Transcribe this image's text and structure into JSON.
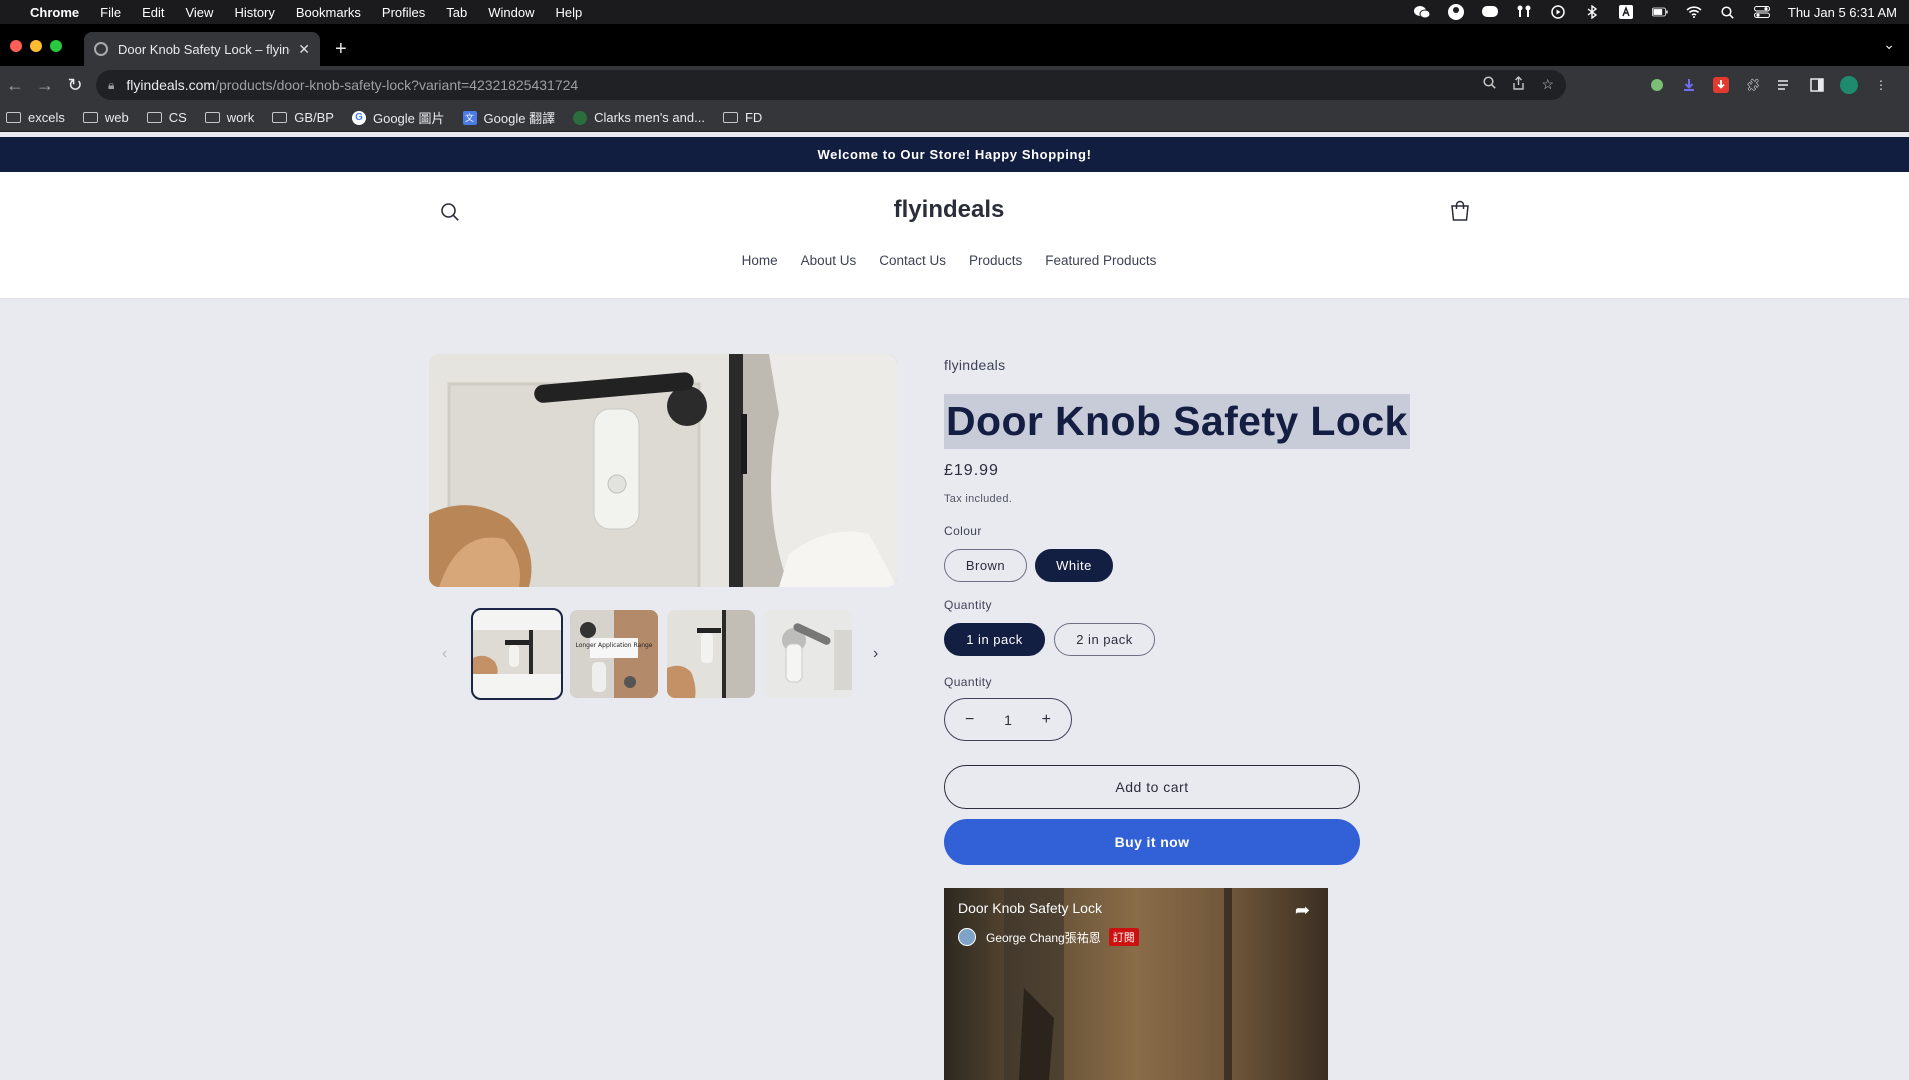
{
  "mac_menubar": {
    "app": "Chrome",
    "items": [
      "File",
      "Edit",
      "View",
      "History",
      "Bookmarks",
      "Profiles",
      "Tab",
      "Window",
      "Help"
    ],
    "clock": "Thu Jan 5  6:31 AM"
  },
  "browser": {
    "tab_title": "Door Knob Safety Lock – flyind",
    "url_host": "flyindeals.com",
    "url_path": "/products/door-knob-safety-lock?variant=42321825431724",
    "bookmarks": [
      {
        "label": "excels",
        "icon": "folder-icon"
      },
      {
        "label": "web",
        "icon": "folder-icon"
      },
      {
        "label": "CS",
        "icon": "folder-icon"
      },
      {
        "label": "work",
        "icon": "folder-icon"
      },
      {
        "label": "GB/BP",
        "icon": "folder-icon"
      },
      {
        "label": "Google 圖片",
        "icon": "google-icon"
      },
      {
        "label": "Google 翻譯",
        "icon": "translate-icon"
      },
      {
        "label": "Clarks men's and...",
        "icon": "site-icon"
      },
      {
        "label": "FD",
        "icon": "folder-icon"
      }
    ]
  },
  "store": {
    "announcement": "Welcome to Our Store! Happy Shopping!",
    "brand": "flyindeals",
    "nav": [
      "Home",
      "About Us",
      "Contact Us",
      "Products",
      "Featured Products"
    ]
  },
  "product": {
    "vendor": "flyindeals",
    "title": "Door Knob Safety Lock",
    "price": "£19.99",
    "tax_note": "Tax included.",
    "colour_label": "Colour",
    "colours": [
      "Brown",
      "White"
    ],
    "selected_colour": "White",
    "pack_label": "Quantity",
    "packs": [
      "1 in pack",
      "2 in pack"
    ],
    "selected_pack": "1 in pack",
    "quantity_label": "Quantity",
    "quantity": "1",
    "add_to_cart": "Add to cart",
    "buy_now": "Buy it now",
    "thumbnail_text": "Longer Application Range"
  },
  "video": {
    "title": "Door Knob Safety Lock",
    "channel": "George Chang張祐恩",
    "subscribe": "訂閱"
  },
  "colors": {
    "announcement_bg": "#121e3f",
    "selected_pill": "#121e42",
    "buy_button": "#3260d6",
    "page_bg": "#e9eaf0"
  }
}
